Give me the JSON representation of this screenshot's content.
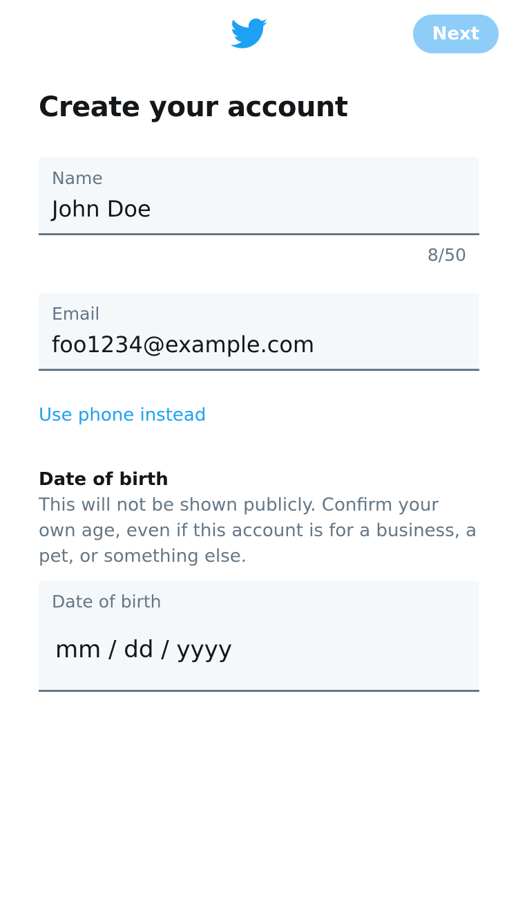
{
  "header": {
    "logo_icon": "twitter-bird-icon",
    "brand_color": "#1da1f2",
    "next_label": "Next",
    "next_color": "#8ecdf8"
  },
  "title": "Create your account",
  "name_field": {
    "label": "Name",
    "value": "John Doe",
    "counter": "8/50"
  },
  "email_field": {
    "label": "Email",
    "value": "foo1234@example.com"
  },
  "phone_link": "Use phone instead",
  "dob": {
    "heading": "Date of birth",
    "description": "This will not be shown publicly. Confirm your own age, even if this account is for a business, a pet, or something else.",
    "field_label": "Date of birth",
    "placeholder": "mm / dd / yyyy"
  }
}
